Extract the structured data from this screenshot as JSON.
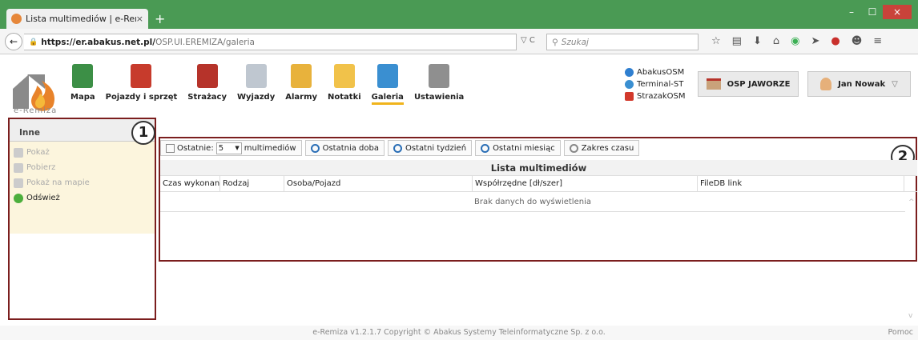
{
  "browser": {
    "tab_title": "Lista multimediów | e-Rem...",
    "tab_close": "×",
    "new_tab": "+",
    "url_host": "https://er.abakus.net.pl/",
    "url_path": "OSP.UI.EREMIZA/galeria",
    "search_placeholder": "Szukaj",
    "url_icons": "▽ C",
    "win_min": "–",
    "win_max": "☐",
    "win_close": "×"
  },
  "logo_text": "e-Remiza",
  "menu": [
    {
      "label": "Mapa",
      "icon": "map-icon",
      "color": "#3c8f46"
    },
    {
      "label": "Pojazdy i sprzęt",
      "icon": "fire-truck-icon",
      "color": "#c73b2c"
    },
    {
      "label": "Strażacy",
      "icon": "firefighter-icon",
      "color": "#b6332a"
    },
    {
      "label": "Wyjazdy",
      "icon": "document-icon",
      "color": "#bfc7d0"
    },
    {
      "label": "Alarmy",
      "icon": "bell-icon",
      "color": "#e8b23c"
    },
    {
      "label": "Notatki",
      "icon": "notes-icon",
      "color": "#f1c24a"
    },
    {
      "label": "Galeria",
      "icon": "gallery-icon",
      "color": "#3a8fd1"
    },
    {
      "label": "Ustawienia",
      "icon": "tools-icon",
      "color": "#8f8f8f"
    }
  ],
  "links": [
    {
      "label": "AbakusOSM",
      "color": "#2f7fd0"
    },
    {
      "label": "Terminal-ST",
      "color": "#3a8fd1"
    },
    {
      "label": "StrazakOSM",
      "color": "#d2392c"
    }
  ],
  "osp_button": "OSP JAWORZE",
  "user_button": "Jan Nowak",
  "user_chevron": "▽",
  "sidebar": {
    "title": "Inne",
    "items": [
      {
        "label": "Pokaż",
        "enabled": false
      },
      {
        "label": "Pobierz",
        "enabled": false
      },
      {
        "label": "Pokaż na mapie",
        "enabled": false
      },
      {
        "label": "Odśwież",
        "enabled": true
      }
    ]
  },
  "badges": {
    "one": "1",
    "two": "2"
  },
  "toolbar": {
    "last_label": "Ostatnie:",
    "last_value": "5",
    "last_suffix": "multimediów",
    "buttons": [
      "Ostatnia doba",
      "Ostatni tydzień",
      "Ostatni miesiąc",
      "Zakres czasu"
    ]
  },
  "grid": {
    "title": "Lista multimediów",
    "columns": [
      "Czas wykonania",
      "Rodzaj",
      "Osoba/Pojazd",
      "Współrzędne [dł/szer]",
      "FileDB link"
    ],
    "empty_text": "Brak danych do wyświetlenia"
  },
  "footer": {
    "text": "e-Remiza v1.2.1.7 Copyright © Abakus Systemy Teleinformatyczne Sp. z o.o.",
    "help": "Pomoc"
  }
}
